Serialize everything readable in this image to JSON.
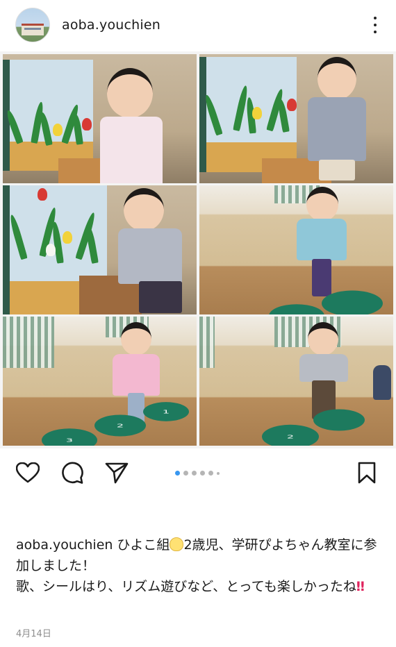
{
  "header": {
    "username": "aoba.youchien",
    "avatar_icon": "school-building-avatar",
    "more_icon": "more-vertical-icon"
  },
  "post": {
    "photo_count": 6,
    "carousel": {
      "active_index": 0,
      "dot_count": 6
    }
  },
  "actions": {
    "like_icon": "heart-icon",
    "comment_icon": "comment-bubble-icon",
    "share_icon": "paper-plane-icon",
    "save_icon": "bookmark-icon",
    "active_dot_color": "#3897f0"
  },
  "caption": {
    "username": "aoba.youchien",
    "part1": "ひよこ組",
    "emoji_chick": "chick-emoji",
    "part2": "2歳児、学研ぴよちゃん教室に参加しました！",
    "line2": "歌、シールはり、リズム遊びなど、とっても楽しかったね",
    "exclamation": "‼"
  },
  "date": "4月14日"
}
